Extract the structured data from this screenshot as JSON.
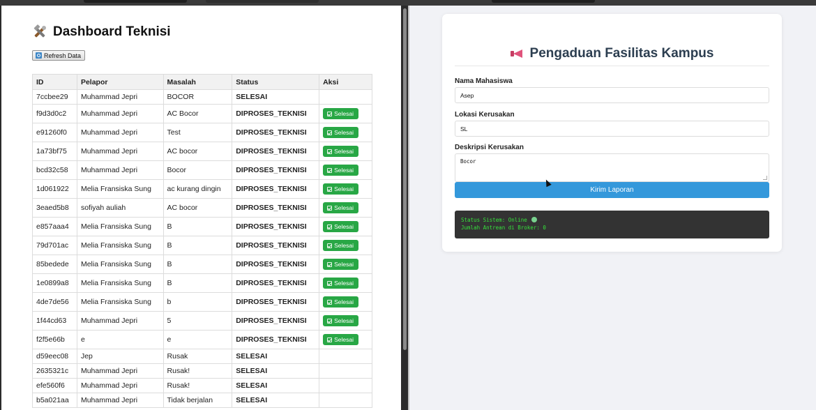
{
  "dashboard": {
    "title": "Dashboard Teknisi",
    "title_icon": "tools-icon",
    "refresh_label": "Refresh Data",
    "refresh_icon": "refresh-icon",
    "columns": [
      "ID",
      "Pelapor",
      "Masalah",
      "Status",
      "Aksi"
    ],
    "action_label": "Selesai",
    "rows": [
      {
        "id": "7ccbee29",
        "pelapor": "Muhammad Jepri",
        "masalah": "BOCOR",
        "status": "SELESAI",
        "action": false
      },
      {
        "id": "f9d3d0c2",
        "pelapor": "Muhammad Jepri",
        "masalah": "AC Bocor",
        "status": "DIPROSES_TEKNISI",
        "action": true
      },
      {
        "id": "e91260f0",
        "pelapor": "Muhammad Jepri",
        "masalah": "Test",
        "status": "DIPROSES_TEKNISI",
        "action": true
      },
      {
        "id": "1a73bf75",
        "pelapor": "Muhammad Jepri",
        "masalah": "AC bocor",
        "status": "DIPROSES_TEKNISI",
        "action": true
      },
      {
        "id": "bcd32c58",
        "pelapor": "Muhammad Jepri",
        "masalah": "Bocor",
        "status": "DIPROSES_TEKNISI",
        "action": true
      },
      {
        "id": "1d061922",
        "pelapor": "Melia Fransiska Sung",
        "masalah": "ac kurang dingin",
        "status": "DIPROSES_TEKNISI",
        "action": true
      },
      {
        "id": "3eaed5b8",
        "pelapor": "sofiyah auliah",
        "masalah": "AC bocor",
        "status": "DIPROSES_TEKNISI",
        "action": true
      },
      {
        "id": "e857aaa4",
        "pelapor": "Melia Fransiska Sung",
        "masalah": "B",
        "status": "DIPROSES_TEKNISI",
        "action": true
      },
      {
        "id": "79d701ac",
        "pelapor": "Melia Fransiska Sung",
        "masalah": "B",
        "status": "DIPROSES_TEKNISI",
        "action": true
      },
      {
        "id": "85bedede",
        "pelapor": "Melia Fransiska Sung",
        "masalah": "B",
        "status": "DIPROSES_TEKNISI",
        "action": true
      },
      {
        "id": "1e0899a8",
        "pelapor": "Melia Fransiska Sung",
        "masalah": "B",
        "status": "DIPROSES_TEKNISI",
        "action": true
      },
      {
        "id": "4de7de56",
        "pelapor": "Melia Fransiska Sung",
        "masalah": "b",
        "status": "DIPROSES_TEKNISI",
        "action": true
      },
      {
        "id": "1f44cd63",
        "pelapor": "Muhammad Jepri",
        "masalah": "5",
        "status": "DIPROSES_TEKNISI",
        "action": true
      },
      {
        "id": "f2f5e66b",
        "pelapor": "e",
        "masalah": "e",
        "status": "DIPROSES_TEKNISI",
        "action": true
      },
      {
        "id": "d59eec08",
        "pelapor": "Jep",
        "masalah": "Rusak",
        "status": "SELESAI",
        "action": false
      },
      {
        "id": "2635321c",
        "pelapor": "Muhammad Jepri",
        "masalah": "Rusak!",
        "status": "SELESAI",
        "action": false
      },
      {
        "id": "efe560f6",
        "pelapor": "Muhammad Jepri",
        "masalah": "Rusak!",
        "status": "SELESAI",
        "action": false
      },
      {
        "id": "b5a021aa",
        "pelapor": "Muhammad Jepri",
        "masalah": "Tidak berjalan",
        "status": "SELESAI",
        "action": false
      }
    ]
  },
  "form": {
    "title": "Pengaduan Fasilitas Kampus",
    "title_icon": "megaphone-icon",
    "name_label": "Nama Mahasiswa",
    "name_value": "Asep",
    "location_label": "Lokasi Kerusakan",
    "location_value": "SL",
    "description_label": "Deskripsi Kerusakan",
    "description_value": "Bocor",
    "submit_label": "Kirim Laporan",
    "status_line": "Status Sistem: Online",
    "queue_line": "Jumlah Antrean di Broker: 0"
  },
  "colors": {
    "accent_blue": "#3498db",
    "success_green": "#28a745",
    "console_bg": "#333333",
    "console_text": "#35e03b"
  }
}
